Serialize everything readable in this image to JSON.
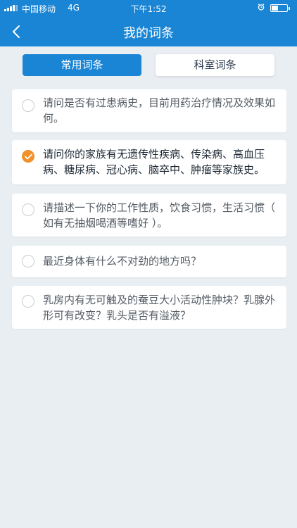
{
  "status_bar": {
    "carrier": "中国移动",
    "network": "4G",
    "time": "下午1:52",
    "battery_level": 0.45
  },
  "nav": {
    "title": "我的词条",
    "back_icon": "chevron-left-icon"
  },
  "tabs": [
    {
      "label": "常用词条",
      "active": true
    },
    {
      "label": "科室词条",
      "active": false
    }
  ],
  "items": [
    {
      "text": "请问是否有过患病史，目前用药治疗情况及效果如何。",
      "checked": false
    },
    {
      "text": "请问你的家族有无遗传性疾病、传染病、高血压病、糖尿病、冠心病、脑卒中、肿瘤等家族史。",
      "checked": true
    },
    {
      "text": "请描述一下你的工作性质，饮食习惯，生活习惯（ 如有无抽烟喝酒等嗜好 ）。",
      "checked": false
    },
    {
      "text": "最近身体有什么不对劲的地方吗？",
      "checked": false
    },
    {
      "text": "乳房内有无可触及的蚕豆大小活动性肿块？乳腺外形可有改变？乳头是否有溢液？",
      "checked": false
    }
  ],
  "colors": {
    "primary": "#1a85d4",
    "check": "#f0922b",
    "background": "#e9eef3"
  }
}
